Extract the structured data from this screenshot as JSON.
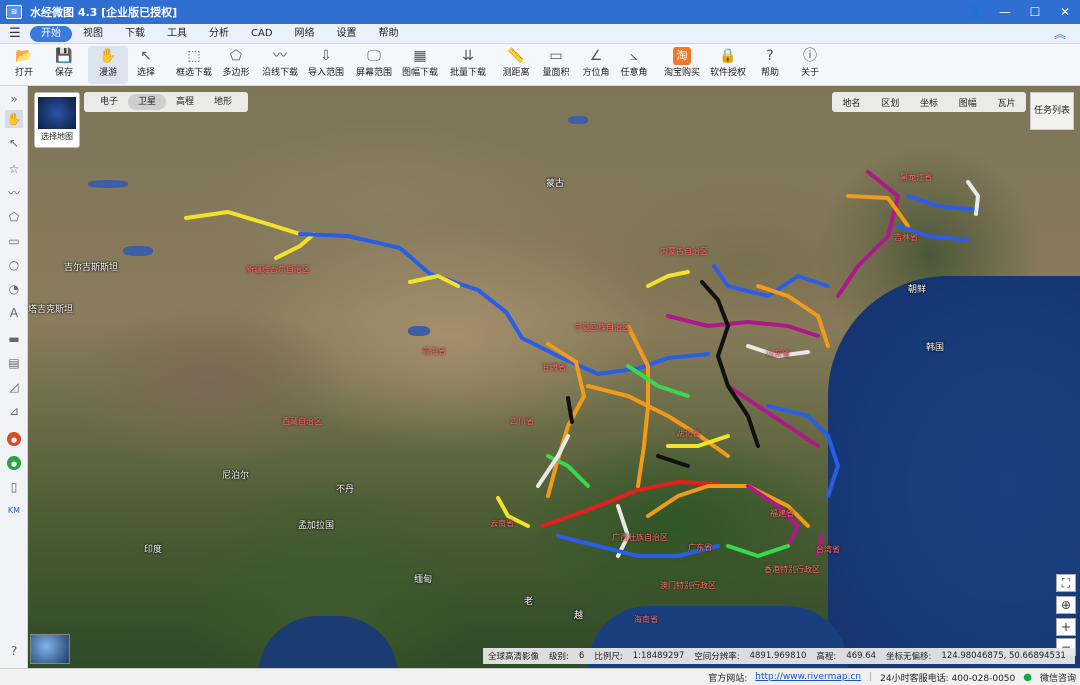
{
  "title": "水经微图 4.3 [企业版已授权]",
  "menu": [
    "开始",
    "视图",
    "下载",
    "工具",
    "分析",
    "CAD",
    "网络",
    "设置",
    "帮助"
  ],
  "toolbar": [
    "打开",
    "保存",
    "漫游",
    "选择",
    "框选下载",
    "多边形",
    "沿线下载",
    "导入范围",
    "屏幕范围",
    "图幅下载",
    "批量下载",
    "测距离",
    "量面积",
    "方位角",
    "任意角",
    "淘宝购买",
    "软件授权",
    "帮助",
    "关于"
  ],
  "maptypes": [
    "电子",
    "卫星",
    "高程",
    "地形"
  ],
  "active_maptype": "卫星",
  "basemap_label": "选择地图",
  "query_tabs": [
    "地名",
    "区划",
    "坐标",
    "图幅",
    "瓦片"
  ],
  "task_list": "任务列表",
  "map_labels": {
    "mongolia": "蒙古",
    "kyrgyz": "吉尔吉斯斯坦",
    "tajik": "塔吉克斯坦",
    "nepal": "尼泊尔",
    "bhutan": "不丹",
    "bangladesh": "孟加拉国",
    "india": "印度",
    "myanmar": "缅甸",
    "laos": "老",
    "vietnam": "越",
    "korea": "朝鲜",
    "south_korea": "韩国",
    "xinjiang": "新疆维吾尔自治区",
    "tibet": "西藏自治区",
    "qinghai": "青海省",
    "gansu": "甘肃省",
    "sichuan": "四川省",
    "yunnan": "云南省",
    "guangxi": "广西壮族自治区",
    "guangdong": "广东省",
    "fujian": "福建省",
    "hubei": "湖北省",
    "shandong": "山东省",
    "heilongjiang": "黑龙江省",
    "jilin": "吉林省",
    "neimenggu": "内蒙古自治区",
    "hainan": "海南省",
    "taiwan": "台湾省",
    "hk": "香港特别行政区",
    "macau": "澳门特别行政区",
    "ningxia": "宁夏回族自治区"
  },
  "infobar": {
    "source": "全球高清影像",
    "level_label": "级别:",
    "level": "6",
    "scale_label": "比例尺:",
    "scale": "1:18489297",
    "resolution_label": "空间分辨率:",
    "resolution": "4891.969810",
    "elev_label": "高程:",
    "elev": "469.64",
    "coord_label": "坐标无偏移:",
    "coord": "124.98046875, 50.66894531"
  },
  "status": {
    "site_label": "官方网站:",
    "site": "http://www.rivermap.cn",
    "phone": "24小时客服电话: 400-028-0050",
    "wechat": "微信咨询"
  },
  "colors": {
    "title_bar": "#2f6fd1",
    "accent": "#3a7be0"
  }
}
